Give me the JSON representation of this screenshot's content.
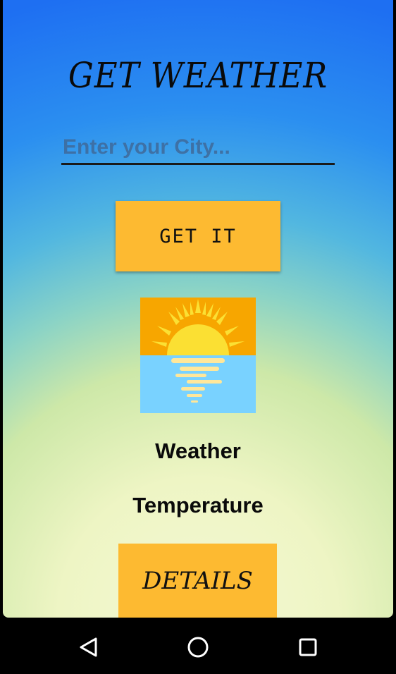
{
  "app": {
    "title": "GET WEATHER",
    "city_input": {
      "placeholder": "Enter your City...",
      "value": ""
    },
    "get_button_label": "GET IT",
    "weather_icon": "sunset-over-water-icon",
    "weather_label": "Weather",
    "temperature_label": "Temperature",
    "details_button_label": "DETAILS"
  },
  "colors": {
    "button": "#fdba31",
    "sky_top": "#1e6ff2",
    "sky_bottom": "#f4f8d4",
    "sun": "#fbe033",
    "sun_bg": "#f7a600",
    "water": "#79d2ff"
  },
  "navbar": {
    "back_icon": "back-triangle-icon",
    "home_icon": "home-circle-icon",
    "recents_icon": "recents-square-icon"
  }
}
